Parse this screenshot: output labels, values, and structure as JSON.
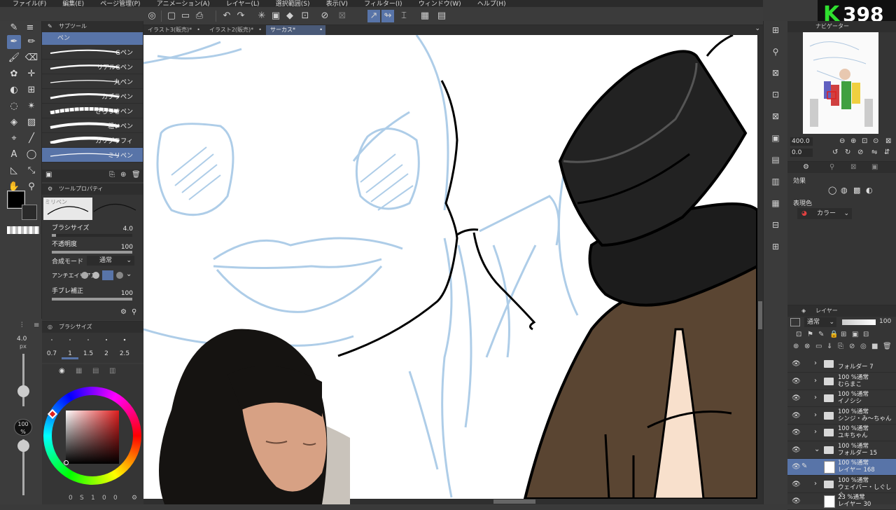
{
  "menu": [
    "ファイル(F)",
    "編集(E)",
    "ページ管理(P)",
    "アニメーション(A)",
    "レイヤー(L)",
    "選択範囲(S)",
    "表示(V)",
    "フィルター(I)",
    "ウィンドウ(W)",
    "ヘルプ(H)"
  ],
  "badge": {
    "letter": "K",
    "number": "398"
  },
  "tabs": [
    {
      "label": "イラスト3(販売)*",
      "active": false
    },
    {
      "label": "イラスト2(販売)*",
      "active": false
    },
    {
      "label": "サーカス*",
      "active": true
    }
  ],
  "subtool": {
    "header": "サブツール",
    "group": "ペン",
    "brushes": [
      "Gペン",
      "リアルGペン",
      "丸ペン",
      "カブラペン",
      "さらつきペン",
      "粗いペン",
      "カリグラフィ",
      "ミリペン"
    ],
    "active_brush": "ミリペン"
  },
  "toolprop": {
    "header": "ツールプロパティ",
    "preview_label": "ミリペン",
    "brush_size_label": "ブラシサイズ",
    "brush_size_value": "4.0",
    "opacity_label": "不透明度",
    "opacity_value": "100",
    "blend_label": "合成モード",
    "blend_value": "通常",
    "antialias_label": "アンチエイリアス",
    "stabilize_label": "手ブレ補正",
    "stabilize_value": "100"
  },
  "brushsize": {
    "header": "ブラシサイズ",
    "current": "4.0",
    "unit": "px",
    "presets": [
      "0.7",
      "1",
      "1.5",
      "2",
      "2.5"
    ]
  },
  "color": {
    "main": "#000000",
    "opacity_value": "100",
    "opacity_unit": "%"
  },
  "navigator": {
    "header": "ナビゲーター",
    "zoom": "400.0",
    "rotate": "0.0"
  },
  "effect": {
    "header": "効果",
    "expression_label": "表現色",
    "expression_value": "カラー"
  },
  "layers": {
    "header": "レイヤー",
    "blend": "通常",
    "opacity": "100",
    "items": [
      {
        "top": "",
        "name": "フォルダー 7",
        "type": "folder",
        "active": false
      },
      {
        "top": "100 %通常",
        "name": "むらまこ",
        "type": "folder",
        "active": false
      },
      {
        "top": "100 %通常",
        "name": "イノシシ",
        "type": "folder",
        "active": false
      },
      {
        "top": "100 %通常",
        "name": "シンジ・み～ちゃん",
        "type": "folder",
        "active": false
      },
      {
        "top": "100 %通常",
        "name": "ユキちゃん",
        "type": "folder",
        "active": false
      },
      {
        "top": "100 %通常",
        "name": "フォルダー 15",
        "type": "folder-open",
        "active": false
      },
      {
        "top": "100 %通常",
        "name": "レイヤー 168",
        "type": "layer",
        "active": true
      },
      {
        "top": "100 %通常",
        "name": "ウェイバー・しぐしぐ",
        "type": "folder",
        "active": false
      },
      {
        "top": "23 %通常",
        "name": "レイヤー 30",
        "type": "layer",
        "active": false
      }
    ]
  },
  "bottom_status": [
    "0",
    "S",
    "1",
    "0",
    "0"
  ]
}
